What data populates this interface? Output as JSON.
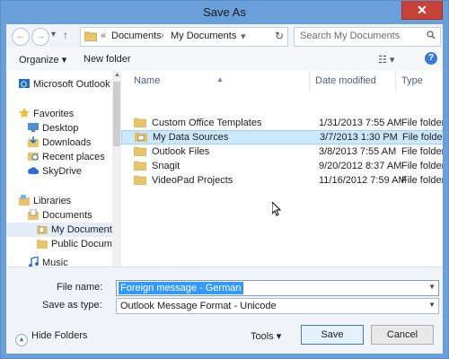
{
  "window": {
    "title": "Save As",
    "close_glyph": "✕"
  },
  "address": {
    "back_glyph": "←",
    "forward_glyph": "→",
    "recent_glyph": "▾",
    "up_glyph": "↑",
    "sep_glyph": "«",
    "crumbs": [
      "Documents",
      "My Documents"
    ],
    "crumb_sep": "›",
    "refresh_glyph": "↻"
  },
  "search": {
    "placeholder": "Search My Documents"
  },
  "toolbar": {
    "organize": "Organize ▾",
    "new_folder": "New folder",
    "view_glyph": "☷ ▾",
    "help": "?"
  },
  "nav": {
    "items": [
      {
        "label": "Microsoft Outlook",
        "icon": "outlook-icon"
      },
      {
        "label": "Favorites",
        "icon": "star-icon"
      },
      {
        "label": "Desktop",
        "icon": "desktop-icon"
      },
      {
        "label": "Downloads",
        "icon": "downloads-icon"
      },
      {
        "label": "Recent places",
        "icon": "recent-places-icon"
      },
      {
        "label": "SkyDrive",
        "icon": "cloud-icon"
      },
      {
        "label": "Libraries",
        "icon": "libraries-icon"
      },
      {
        "label": "Documents",
        "icon": "documents-icon"
      },
      {
        "label": "My Documents",
        "icon": "folder-icon"
      },
      {
        "label": "Public Docume",
        "icon": "folder-icon"
      },
      {
        "label": "Music",
        "icon": "music-icon"
      }
    ]
  },
  "list": {
    "columns": [
      "Name",
      "Date modified",
      "Type"
    ],
    "rows": [
      {
        "name": "Custom Office Templates",
        "date": "1/31/2013 7:55 AM",
        "type": "File folder"
      },
      {
        "name": "My Data Sources",
        "date": "3/7/2013 1:30 PM",
        "type": "File folder"
      },
      {
        "name": "Outlook Files",
        "date": "3/8/2013 7:55 AM",
        "type": "File folder"
      },
      {
        "name": "Snagit",
        "date": "9/20/2012 8:37 AM",
        "type": "File folder"
      },
      {
        "name": "VideoPad Projects",
        "date": "11/16/2012 7:59 AM",
        "type": "File folder"
      }
    ],
    "selected_index": 1
  },
  "form": {
    "file_name_label": "File name:",
    "file_name_value": "Foreign message - German",
    "save_as_type_label": "Save as type:",
    "save_as_type_value": "Outlook Message Format - Unicode"
  },
  "footer": {
    "hide_folders": "Hide Folders",
    "tools": "Tools ▾",
    "save": "Save",
    "cancel": "Cancel"
  },
  "colors": {
    "title_bar": "#6aa0d9",
    "close": "#c7433a",
    "selection": "#cce8ff",
    "text_highlight": "#3399ff"
  }
}
